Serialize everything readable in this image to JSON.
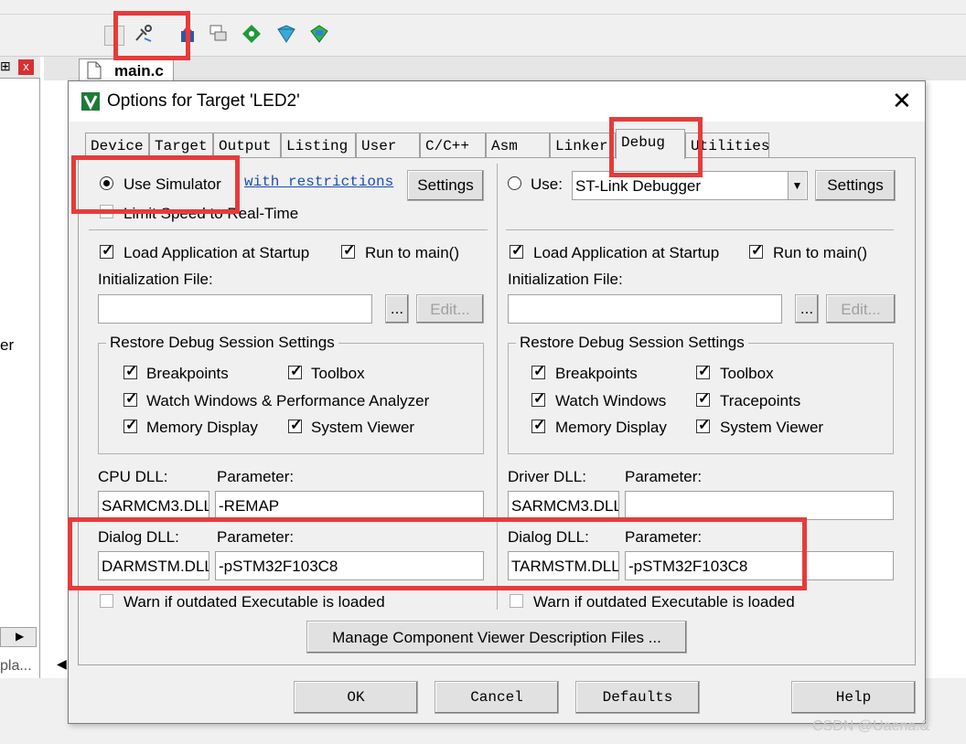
{
  "ide": {
    "file_tab": "main.c",
    "left_text": "er",
    "left_bottom": "pla...",
    "close_char": "x"
  },
  "dialog": {
    "title": "Options for Target 'LED2'",
    "close_glyph": "✕",
    "tabs": [
      {
        "label": "Device"
      },
      {
        "label": "Target"
      },
      {
        "label": "Output"
      },
      {
        "label": "Listing"
      },
      {
        "label": "User"
      },
      {
        "label": "C/C++"
      },
      {
        "label": "Asm"
      },
      {
        "label": "Linker"
      },
      {
        "label": "Debug",
        "active": true
      },
      {
        "label": "Utilities"
      }
    ],
    "left": {
      "use_simulator": "Use Simulator",
      "with_restrictions": "with restrictions",
      "settings": "Settings",
      "limit_speed": "Limit Speed to Real-Time",
      "load_app": "Load Application at Startup",
      "run_to_main": "Run to main()",
      "init_file_label": "Initialization File:",
      "browse": "...",
      "edit": "Edit...",
      "restore_group": "Restore Debug Session Settings",
      "restore_items": [
        "Breakpoints",
        "Toolbox",
        "Watch Windows & Performance Analyzer",
        "Memory Display",
        "System Viewer"
      ],
      "cpu_dll_label": "CPU DLL:",
      "cpu_param_label": "Parameter:",
      "cpu_dll": "SARMCM3.DLL",
      "cpu_param": "-REMAP",
      "dialog_dll_label": "Dialog DLL:",
      "dialog_param_label": "Parameter:",
      "dialog_dll": "DARMSTM.DLL",
      "dialog_param": "-pSTM32F103C8",
      "warn": "Warn if outdated Executable is loaded"
    },
    "right": {
      "use": "Use:",
      "debugger": "ST-Link Debugger",
      "settings": "Settings",
      "load_app": "Load Application at Startup",
      "run_to_main": "Run to main()",
      "init_file_label": "Initialization File:",
      "browse": "...",
      "edit": "Edit...",
      "restore_group": "Restore Debug Session Settings",
      "restore_items": [
        "Breakpoints",
        "Toolbox",
        "Watch Windows",
        "Tracepoints",
        "Memory Display",
        "System Viewer"
      ],
      "driver_dll_label": "Driver DLL:",
      "driver_param_label": "Parameter:",
      "driver_dll": "SARMCM3.DLL",
      "driver_param": "",
      "dialog_dll_label": "Dialog DLL:",
      "dialog_param_label": "Parameter:",
      "dialog_dll": "TARMSTM.DLL",
      "dialog_param": "-pSTM32F103C8",
      "warn": "Warn if outdated Executable is loaded"
    },
    "manage_button": "Manage Component Viewer Description Files ...",
    "buttons": {
      "ok": "OK",
      "cancel": "Cancel",
      "defaults": "Defaults",
      "help": "Help"
    }
  },
  "watermark": "CSDN @Uaena.&",
  "colors": {
    "highlight": "#e83a3a",
    "link": "#1a4fb0"
  }
}
